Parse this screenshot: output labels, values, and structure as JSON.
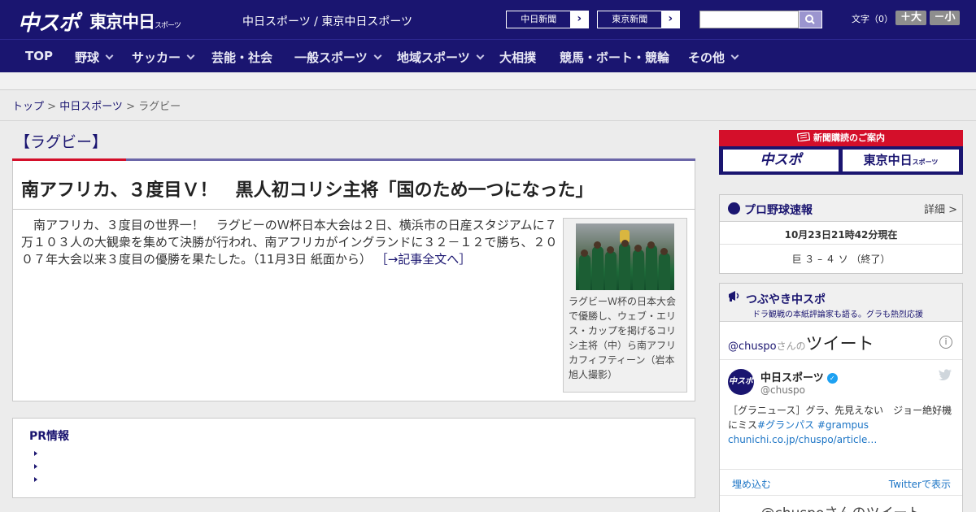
{
  "header": {
    "logo_chuspo": "中スポ",
    "logo_tokyo": "東京中日",
    "logo_tokyo_sub": "スポーツ",
    "site_links": "中日スポーツ / 東京中日スポーツ",
    "ext_links": [
      "中日新聞",
      "東京新聞"
    ],
    "font_size_label": "文字（0）",
    "font_plus": "＋大",
    "font_minus": "－小"
  },
  "nav": {
    "items": [
      {
        "label": "TOP"
      },
      {
        "label": "野球"
      },
      {
        "label": "サッカー"
      },
      {
        "label": "芸能・社会"
      },
      {
        "label": "一般スポーツ"
      },
      {
        "label": "地域スポーツ"
      },
      {
        "label": "大相撲"
      },
      {
        "label": "競馬・ボート・競輪"
      },
      {
        "label": "その他"
      }
    ]
  },
  "breadcrumb": {
    "top": "トップ",
    "sep": " > ",
    "section": "中日スポーツ",
    "current": "ラグビー"
  },
  "category": {
    "title": "【ラグビー】"
  },
  "article": {
    "headline": "南アフリカ、３度目Ｖ！　黒人初コリシ主将「国のため一つになった」",
    "body": "　南アフリカ、３度目の世界一！　ラグビーのＷ杯日本大会は２日、横浜市の日産スタジアムに７万１０３人の大観衆を集めて決勝が行われ、南アフリカがイングランドに３２－１２で勝ち、２００７年大会以来３度目の優勝を果たした。（11月3日 紙面から）",
    "read_more": "［→記事全文へ］",
    "photo_caption": "ラグビーＷ杯の日本大会で優勝し、ウェブ・エリス・カップを掲げるコリシ主将（中）ら南アフリカフィフティーン（岩本旭人撮影）"
  },
  "pr": {
    "title": "PR情報"
  },
  "subscribe_banner": {
    "header": "新聞購読のご案内",
    "left_logo": "中スポ",
    "right_logo": "東京中日",
    "right_logo_sub": "スポーツ"
  },
  "baseball": {
    "title": "プロ野球速報",
    "detail_link": "詳細 >",
    "timestamp": "10月23日21時42分現在",
    "score": "巨 ３ – ４ ソ （終了）"
  },
  "tweets": {
    "title": "つぶやき中スポ",
    "subtitle": "ドラ観戦の本紙評論家も語る。グラも熱烈応援",
    "handle_at": "@chuspo",
    "handle_san": "さんの",
    "handle_tweet": "ツイート",
    "info_icon": "i",
    "tweet": {
      "avatar_text": "中スポ",
      "author": "中日スポーツ",
      "username": "@chuspo",
      "text_prefix": "［グラニュース］グラ、先見えない　ジョー絶好機にミス",
      "hashtag1": "#グランパス",
      "hashtag2": " #grampus",
      "link": "chunichi.co.jp/chuspo/article…"
    },
    "embed_label": "埋め込む",
    "view_label": "Twitterで表示",
    "bottom_text": "@chuspoさんのツイート"
  }
}
